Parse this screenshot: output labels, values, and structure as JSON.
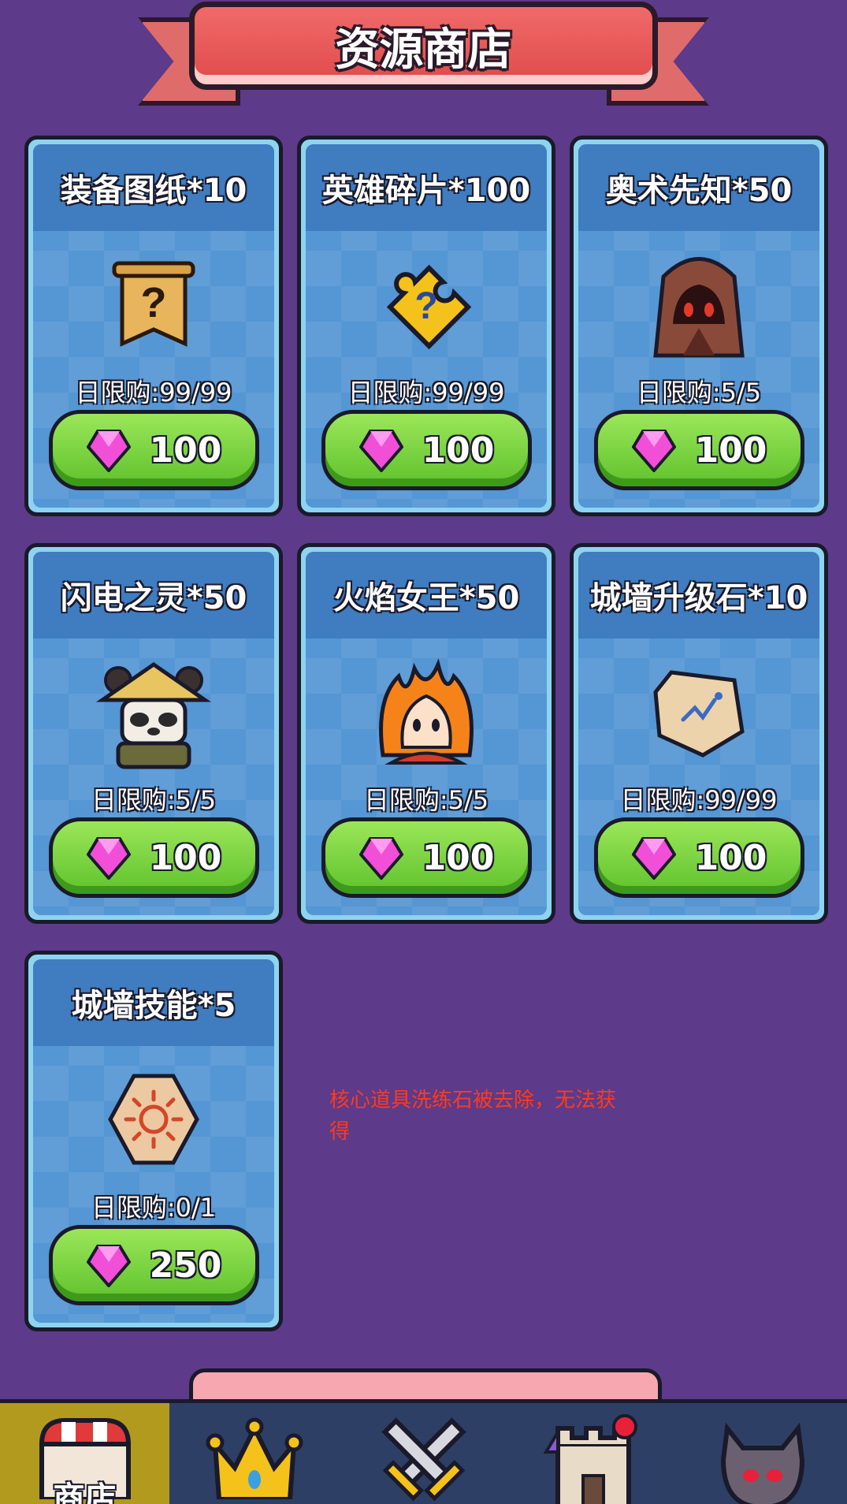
{
  "header": {
    "title": "资源商店"
  },
  "items": [
    {
      "title": "装备图纸*10",
      "limit": "日限购:99/99",
      "price": "100",
      "icon": "scroll-icon"
    },
    {
      "title": "英雄碎片*100",
      "limit": "日限购:99/99",
      "price": "100",
      "icon": "puzzle-icon"
    },
    {
      "title": "奥术先知*50",
      "limit": "日限购:5/5",
      "price": "100",
      "icon": "hooded-mage-icon"
    },
    {
      "title": "闪电之灵*50",
      "limit": "日限购:5/5",
      "price": "100",
      "icon": "panda-hero-icon"
    },
    {
      "title": "火焰女王*50",
      "limit": "日限购:5/5",
      "price": "100",
      "icon": "fire-queen-icon"
    },
    {
      "title": "城墙升级石*10",
      "limit": "日限购:99/99",
      "price": "100",
      "icon": "rune-stone-icon"
    },
    {
      "title": "城墙技能*5",
      "limit": "日限购:0/1",
      "price": "250",
      "icon": "sun-hex-icon"
    }
  ],
  "currency_icon": "pink-gem-icon",
  "note": "核心道具洗练石被去除，无法获得",
  "nav": {
    "items": [
      {
        "label": "商店",
        "icon": "shop-icon",
        "active": true
      },
      {
        "label": "",
        "icon": "crown-icon",
        "active": false
      },
      {
        "label": "",
        "icon": "crossed-swords-icon",
        "active": false
      },
      {
        "label": "",
        "icon": "castle-icon",
        "active": false
      },
      {
        "label": "",
        "icon": "monster-icon",
        "active": false
      }
    ]
  },
  "colors": {
    "background": "#5d3a8a",
    "card": "#5596d4",
    "button": "#6fcf3a",
    "ribbon": "#e04a4a",
    "note": "#ff3a1a"
  }
}
